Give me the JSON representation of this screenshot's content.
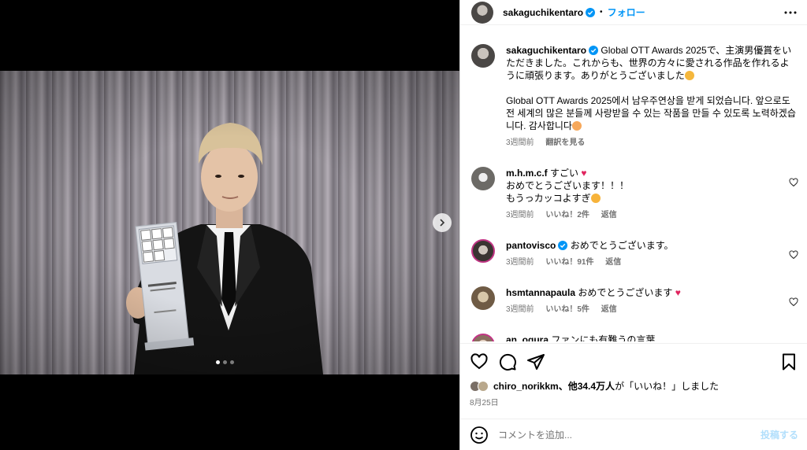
{
  "post": {
    "username": "sakaguchikentaro",
    "follow_label": "フォロー",
    "dot": "•",
    "caption_jp": "Global OTT Awards 2025で、主演男優賞をいただきました。これからも、世界の方々に愛される作品を作れるように頑張ります。ありがとうございました",
    "caption_kr": "Global OTT Awards 2025에서 남우주연상을 받게 되었습니다. 앞으로도 전 세계의 많은 분들께 사랑받을 수 있는 작품을 만들 수 있도록 노력하겠습니다. 감사합니다",
    "caption_time": "3週間前",
    "translate_label": "翻訳を見る",
    "likes_user": "chiro_norikkm",
    "likes_text_mid": "、他34.4万人",
    "likes_text_tail": "が「いいね！」しました",
    "date": "8月25日",
    "comment_placeholder": "コメントを追加...",
    "post_label": "投稿する",
    "slide_count": 3,
    "active_slide": 1
  },
  "comments": [
    {
      "user": "m.h.m.c.f",
      "verified": false,
      "text_line1": "すごい",
      "text_line2": "おめでとうございます！！！",
      "text_line3": "もうっカッコよすぎ",
      "time": "3週間前",
      "likes": "いいね！2件",
      "reply": "返信"
    },
    {
      "user": "pantovisco",
      "verified": true,
      "text_line1": "おめでとうございます。",
      "time": "3週間前",
      "likes": "いいね！91件",
      "reply": "返信"
    },
    {
      "user": "hsmtannapaula",
      "verified": false,
      "text_line1": "おめでとうございます",
      "time": "3週間前",
      "likes": "いいね！5件",
      "reply": "返信"
    },
    {
      "user": "an_ogura",
      "verified": false,
      "text_line1": "ファンにも有難うの言葉"
    }
  ],
  "colors": {
    "accent": "#0095f6",
    "muted": "#737373",
    "heart": "#ed4956"
  }
}
